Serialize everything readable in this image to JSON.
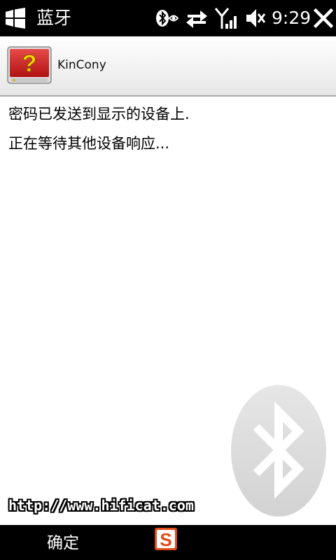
{
  "statusbar": {
    "title": "蓝牙",
    "time": "9:29",
    "icons": [
      "windows-start-icon",
      "bluetooth-visible-icon",
      "data-connection-icon",
      "signal-strength-icon",
      "volume-muted-icon",
      "close-icon"
    ]
  },
  "device": {
    "name": "KinCony",
    "icon": "unknown-device-icon",
    "icon_glyph": "?",
    "icon_color": "#cc1f1f"
  },
  "content": {
    "line1": "密码已发送到显示的设备上.",
    "line2": "正在等待其他设备响应..."
  },
  "watermark": {
    "site": "http://www.hificat.com"
  },
  "softkeys": {
    "left": "确定",
    "center_icon": "sogou-input-icon",
    "center_glyph": "S"
  }
}
